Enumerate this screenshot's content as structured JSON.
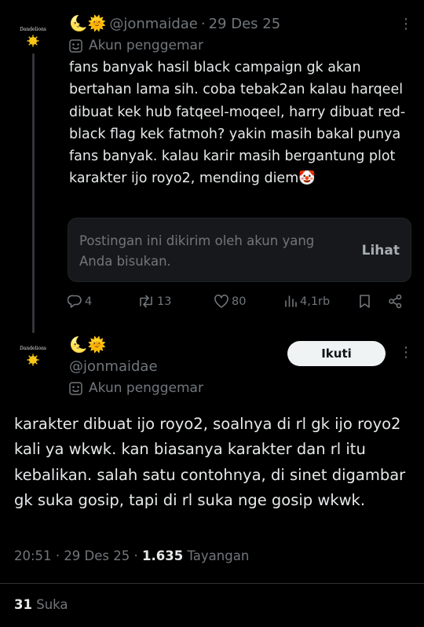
{
  "reply_post": {
    "avatar_text": "Dandelions",
    "header_emojis": "🌜🌞",
    "handle": "@jonmaidae",
    "separator": "·",
    "date": "29 Des 25",
    "more": "⋮",
    "fan_badge": "Akun penggemar",
    "text": "fans banyak hasil black campaign gk akan bertahan lama sih. coba tebak2an kalau harqeel dibuat kek hub fatqeel-moqeel, harry dibuat red-black flag kek fatmoh? yakin masih bakal punya fans banyak. kalau karir masih bergantung plot karakter ijo royo2, mending diem🤡",
    "muted_notice": "Postingan ini dikirim oleh akun yang Anda bisukan.",
    "muted_action": "Lihat",
    "actions": {
      "replies": "4",
      "reposts": "13",
      "likes": "80",
      "views": "4,1rb"
    }
  },
  "main_post": {
    "avatar_text": "Dandelions",
    "header_emojis": "🌜🌞",
    "handle": "@jonmaidae",
    "follow_label": "Ikuti",
    "more": "⋮",
    "fan_badge": "Akun penggemar",
    "text": "karakter dibuat ijo royo2, soalnya di rl gk ijo royo2 kali ya wkwk. kan biasanya karakter dan rl itu kebalikan. salah satu contohnya, di sinet digambar gk suka gosip, tapi di rl suka nge gosip wkwk.",
    "time": "20:51",
    "separator": "·",
    "date": "29 Des 25",
    "views_count": "1.635",
    "views_label": "Tayangan",
    "likes_count": "31",
    "likes_label": "Suka"
  },
  "colors": {
    "background": "#000000",
    "text_primary": "#e7e9ea",
    "text_secondary": "#71767b",
    "card_bg": "#16181c",
    "button_bg": "#eff3f4"
  }
}
